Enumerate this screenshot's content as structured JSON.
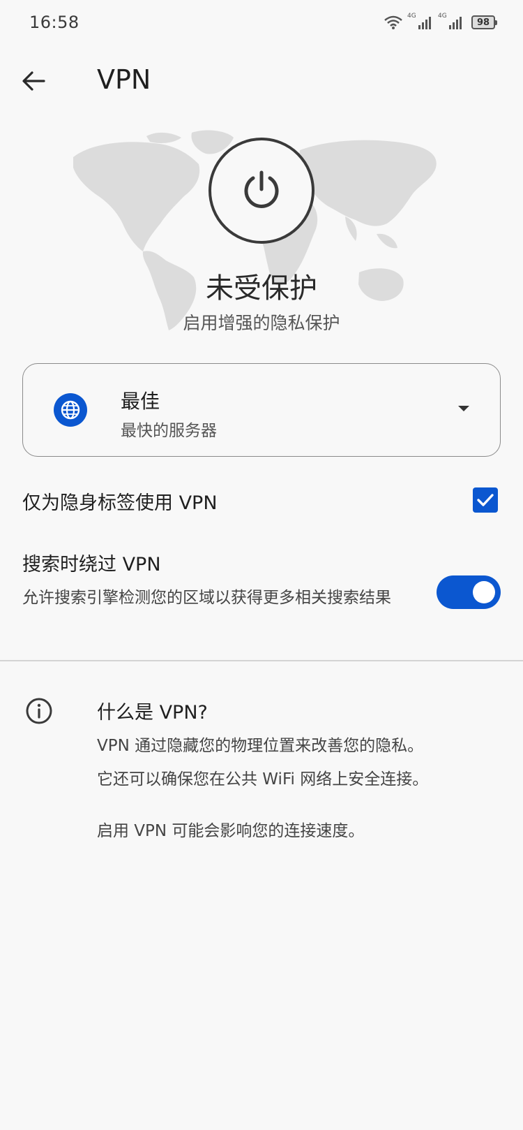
{
  "status_bar": {
    "time": "16:58",
    "network_1": "4G",
    "network_2": "4G",
    "battery": "98"
  },
  "app_bar": {
    "title": "VPN"
  },
  "hero": {
    "status_title": "未受保护",
    "status_subtitle": "启用增强的隐私保护"
  },
  "server": {
    "name": "最佳",
    "description": "最快的服务器"
  },
  "settings": {
    "incognito_only_label": "仅为隐身标签使用 VPN",
    "incognito_only_checked": true,
    "bypass_label": "搜索时绕过 VPN",
    "bypass_description": "允许搜索引擎检测您的区域以获得更多相关搜索结果",
    "bypass_enabled": true
  },
  "info": {
    "title": "什么是 VPN?",
    "line1": "VPN 通过隐藏您的物理位置来改善您的隐私。",
    "line2": "它还可以确保您在公共 WiFi 网络上安全连接。",
    "line3": "启用 VPN 可能会影响您的连接速度。"
  },
  "colors": {
    "accent": "#0b57d0",
    "background": "#f8f8f8",
    "map": "#dcdcdc"
  }
}
